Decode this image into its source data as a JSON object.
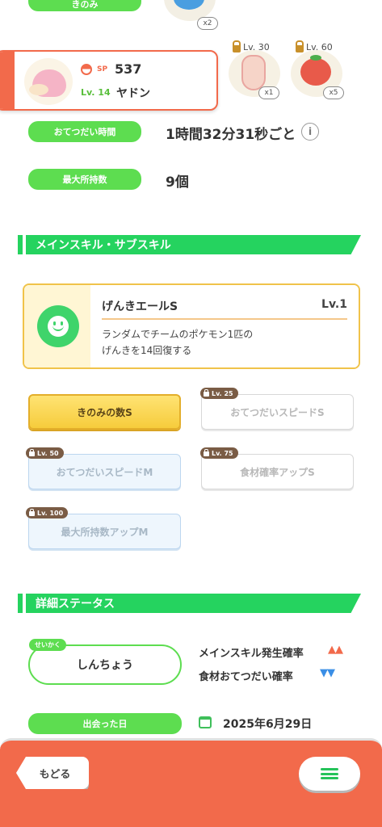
{
  "top_row": {
    "berry_label": "きのみ",
    "berry_qty": "x2",
    "ingredients": [
      {
        "level": "Lv. 30",
        "qty": "x1"
      },
      {
        "level": "Lv. 60",
        "qty": "x5"
      }
    ]
  },
  "pokemon": {
    "sp_label": "SP",
    "sp_value": "537",
    "level": "Lv. 14",
    "name": "ヤドン"
  },
  "help_interval": {
    "label": "おてつだい時間",
    "value": "1時間32分31秒ごと"
  },
  "max_carry": {
    "label": "最大所持数",
    "value": "9個"
  },
  "skills_section": {
    "title": "メインスキル・サブスキル",
    "main_skill": {
      "name": "げんきエールS",
      "level": "Lv.1",
      "desc_line1": "ランダムでチームのポケモン1匹の",
      "desc_line2": "げんきを14回復する"
    },
    "sub_skills": [
      {
        "label": "きのみの数S",
        "unlock": ""
      },
      {
        "label": "おてつだいスピードS",
        "unlock": "Lv. 25"
      },
      {
        "label": "おてつだいスピードM",
        "unlock": "Lv. 50"
      },
      {
        "label": "食材確率アップS",
        "unlock": "Lv. 75"
      },
      {
        "label": "最大所持数アップM",
        "unlock": "Lv. 100"
      }
    ]
  },
  "detail_section": {
    "title": "詳細ステータス",
    "nature_tag": "せいかく",
    "nature": "しんちょう",
    "effects": [
      {
        "label": "メインスキル発生確率",
        "arrows": "▲▲",
        "color": "#f26a4b"
      },
      {
        "label": "食材おてつだい確率",
        "arrows": "▼▼",
        "color": "#3a8ee6"
      }
    ],
    "met_label": "出会った日",
    "met_date": "2025年6月29日"
  },
  "nav": {
    "back": "もどる"
  },
  "colors": {
    "green": "#5ddd50",
    "section_green": "#25d35f",
    "orange": "#f26a4b",
    "gold": "#f6cc3c"
  }
}
